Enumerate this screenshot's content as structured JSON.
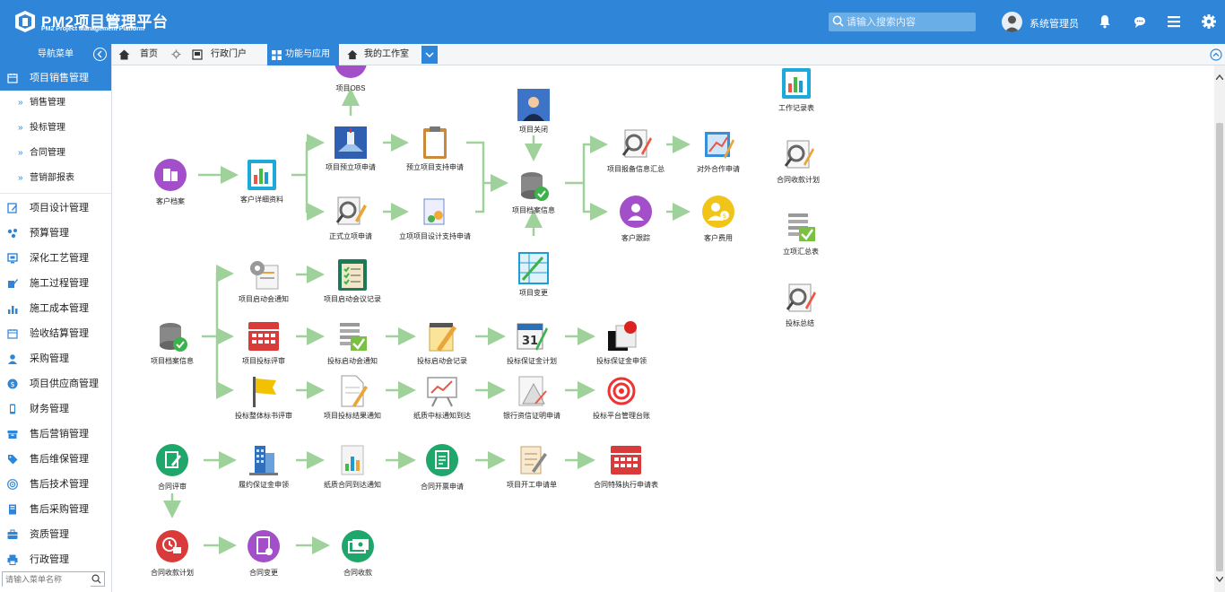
{
  "header": {
    "brand_title": "PM2项目管理平台",
    "brand_sub": "PM2 Project Management Platform",
    "search_placeholder": "请输入搜索内容",
    "username": "系统管理员"
  },
  "sidebar": {
    "title": "导航菜单",
    "search_placeholder": "请输入菜单名称",
    "items": [
      {
        "label": "项目销售管理",
        "icon": "calendar-icon",
        "active": true
      },
      {
        "label": "销售管理",
        "sub": true
      },
      {
        "label": "投标管理",
        "sub": true
      },
      {
        "label": "合同管理",
        "sub": true
      },
      {
        "label": "营销部报表",
        "sub": true
      },
      {
        "label": "项目设计管理",
        "icon": "edit-icon"
      },
      {
        "label": "预算管理",
        "icon": "share-icon"
      },
      {
        "label": "深化工艺管理",
        "icon": "screen-icon"
      },
      {
        "label": "施工过程管理",
        "icon": "pencil-icon"
      },
      {
        "label": "施工成本管理",
        "icon": "bar-chart-icon"
      },
      {
        "label": "验收结算管理",
        "icon": "calendar-icon"
      },
      {
        "label": "采购管理",
        "icon": "user-icon"
      },
      {
        "label": "项目供应商管理",
        "icon": "coin-icon"
      },
      {
        "label": "财务管理",
        "icon": "phone-icon"
      },
      {
        "label": "售后营销管理",
        "icon": "box-icon"
      },
      {
        "label": "售后维保管理",
        "icon": "tag-icon"
      },
      {
        "label": "售后技术管理",
        "icon": "target-icon"
      },
      {
        "label": "售后采购管理",
        "icon": "book-icon"
      },
      {
        "label": "资质管理",
        "icon": "briefcase-icon"
      },
      {
        "label": "行政管理",
        "icon": "printer-icon"
      }
    ]
  },
  "tabs": {
    "home": "首页",
    "admin_portal": "行政门户",
    "functions": "功能与应用",
    "workbench": "我的工作室"
  },
  "flow": {
    "n_obs": "项目OBS",
    "n_customer_file": "客户档案",
    "n_customer_detail": "客户详细资料",
    "n_pre_project": "项目预立项申请",
    "n_pre_support": "预立项目支持申请",
    "n_formal_project": "正式立项申请",
    "n_design_support": "立项项目设计支持申请",
    "n_close": "项目关闭",
    "n_archive": "项目档案信息",
    "n_report_summary": "项目报备信息汇总",
    "n_cooperation": "对外合作申请",
    "n_cust_follow": "客户跟踪",
    "n_cust_cost": "客户费用",
    "n_change": "项目变更",
    "n_work_record": "工作记录表",
    "n_contract_plan_r": "合同收款计划",
    "n_approval_summary": "立项汇总表",
    "n_bid_summary": "投标总结",
    "n_start_notice": "项目启动会通知",
    "n_start_record": "项目启动会议记录",
    "n_archive2": "项目档案信息",
    "n_bid_review": "项目投标评审",
    "n_bid_start_notice": "投标启动会通知",
    "n_bid_start_record": "投标启动会记录",
    "n_bid_bond_plan": "投标保证金计划",
    "n_bid_bond_apply": "投标保证金申领",
    "n_bid_doc_review": "投标整体标书评审",
    "n_bid_result": "项目投标结果通知",
    "n_paper_notice": "纸质中标通知到达",
    "n_bank_cert": "银行资信证明申请",
    "n_platform_ledger": "投标平台管理台账",
    "n_contract_review": "合同评审",
    "n_perf_bond": "履约保证金申领",
    "n_paper_contract": "纸质合同到达通知",
    "n_invoice": "合同开票申请",
    "n_start_work": "项目开工申请单",
    "n_special": "合同特殊执行申请表",
    "n_receipt_plan": "合同收款计划",
    "n_contract_change": "合同变更",
    "n_contract_receipt": "合同收款"
  }
}
